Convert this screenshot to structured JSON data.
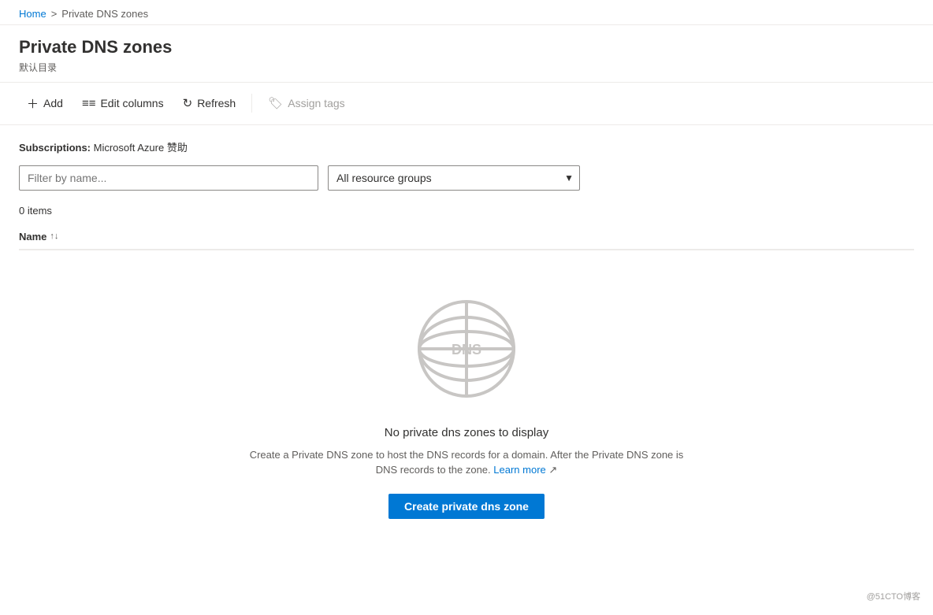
{
  "breadcrumb": {
    "home_label": "Home",
    "separator": ">",
    "current": "Private DNS zones"
  },
  "page": {
    "title": "Private DNS zones",
    "subtitle": "默认目录"
  },
  "toolbar": {
    "add_label": "Add",
    "edit_columns_label": "Edit columns",
    "refresh_label": "Refresh",
    "assign_tags_label": "Assign tags"
  },
  "filters": {
    "subscriptions_label": "Subscriptions:",
    "subscription_value": "Microsoft Azure 赞助",
    "filter_placeholder": "Filter by name...",
    "resource_group_default": "All resource groups",
    "resource_group_options": [
      "All resource groups"
    ]
  },
  "table": {
    "items_count": "0 items",
    "col_name_label": "Name"
  },
  "empty_state": {
    "title": "No private dns zones to display",
    "description": "Create a Private DNS zone to host the DNS records for a domain. After the Private DNS zone is",
    "description2": "DNS records to the zone.",
    "learn_more_label": "Learn more",
    "create_btn_label": "Create private dns zone"
  },
  "watermark": "@51CTO博客"
}
